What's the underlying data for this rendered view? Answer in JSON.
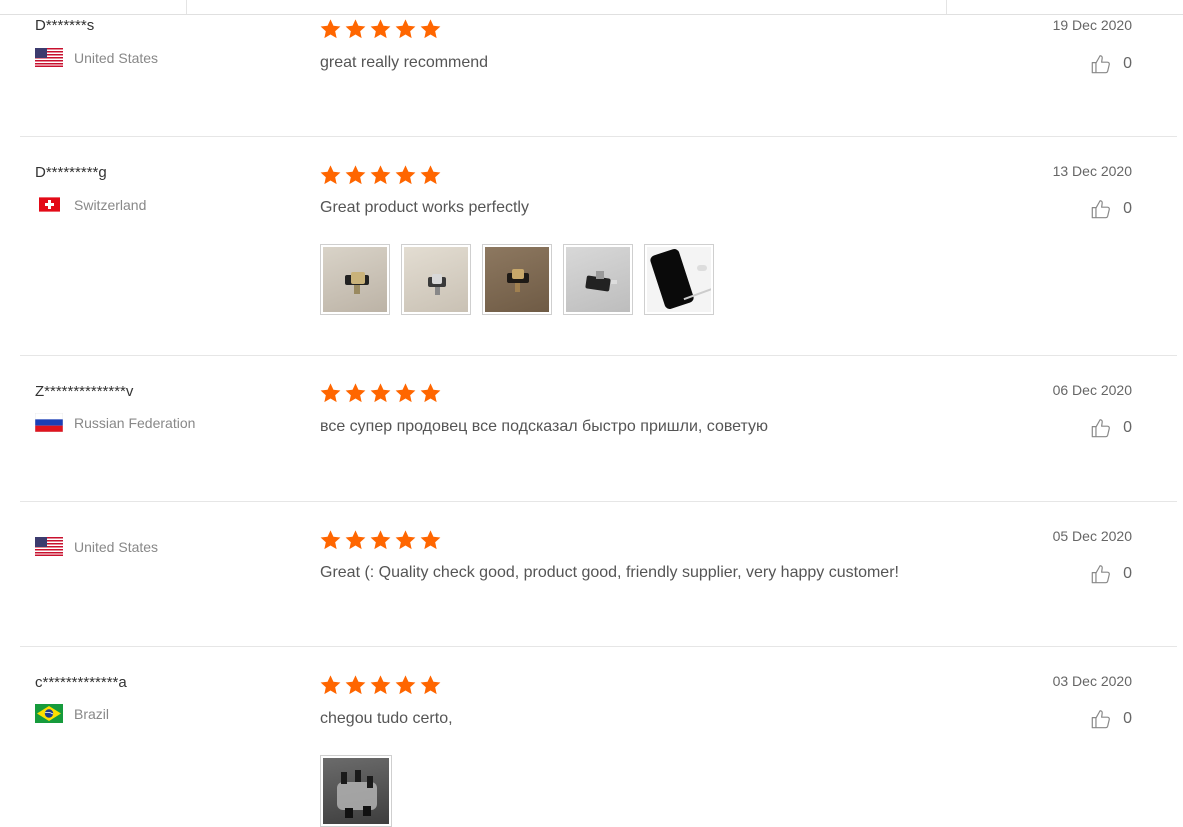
{
  "reviews": [
    {
      "user": "D*******s",
      "country": "United States",
      "flag": "us-flag",
      "rating": 5,
      "text": "great really recommend",
      "date": "19 Dec 2020",
      "helpful": "0",
      "photos": []
    },
    {
      "user": "D*********g",
      "country": "Switzerland",
      "flag": "ch-flag",
      "rating": 5,
      "text": "Great product works perfectly",
      "date": "13 Dec 2020",
      "helpful": "0",
      "photos": [
        "adapter-photo-1",
        "adapter-photo-2",
        "adapter-photo-3",
        "adapter-photo-4",
        "phone-photo"
      ]
    },
    {
      "user": "Z**************v",
      "country": "Russian Federation",
      "flag": "ru-flag",
      "rating": 5,
      "text": "все супер продовец все подсказал быстро пришли, советую",
      "date": "06 Dec 2020",
      "helpful": "0",
      "photos": []
    },
    {
      "user": "",
      "country": "United States",
      "flag": "us-flag",
      "rating": 5,
      "text": "Great (: Quality check good, product good, friendly supplier, very happy customer!",
      "date": "05 Dec 2020",
      "helpful": "0",
      "photos": []
    },
    {
      "user": "c*************a",
      "country": "Brazil",
      "flag": "br-flag",
      "rating": 5,
      "text": "chegou tudo certo,",
      "date": "03 Dec 2020",
      "helpful": "0",
      "photos": [
        "package-photo"
      ]
    }
  ],
  "colors": {
    "star": "#ff6600",
    "separator": "#e6e6e6",
    "text": "#555555"
  }
}
